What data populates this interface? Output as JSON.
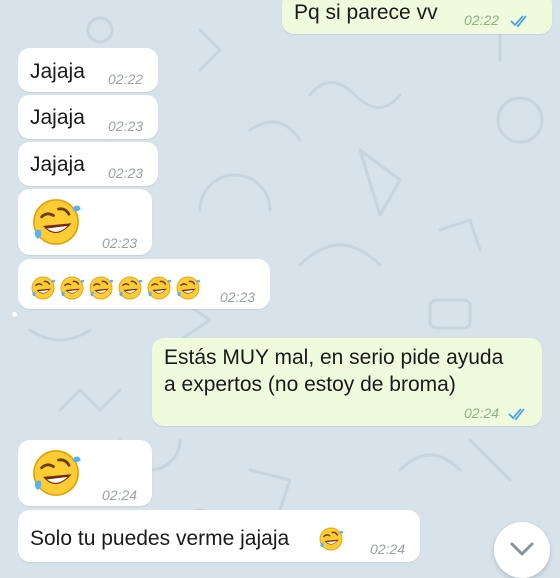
{
  "messages": [
    {
      "dir": "out",
      "text": "Pq si parece vv",
      "time": "02:22",
      "read": true
    },
    {
      "dir": "in",
      "text": "Jajaja",
      "time": "02:22"
    },
    {
      "dir": "in",
      "text": "Jajaja",
      "time": "02:23"
    },
    {
      "dir": "in",
      "text": "Jajaja",
      "time": "02:23"
    },
    {
      "dir": "in",
      "emoji": "rofl",
      "time": "02:23"
    },
    {
      "dir": "in",
      "emoji_count": 6,
      "time": "02:23"
    },
    {
      "dir": "out",
      "text_lines": [
        "Estás MUY mal, en serio pide ayuda",
        "a expertos (no estoy de broma)"
      ],
      "time": "02:24",
      "read": true
    },
    {
      "dir": "in",
      "emoji": "rofl",
      "time": "02:24"
    },
    {
      "dir": "in",
      "text": "Solo tu puedes verme jajaja",
      "time": "02:24"
    }
  ],
  "icons": {
    "emoji": "rolling-on-the-floor-laughing",
    "read_receipt": "double-check",
    "scroll": "chevron-down"
  },
  "colors": {
    "background": "#d7e2ea",
    "incoming_bubble": "#ffffff",
    "outgoing_bubble": "#eefbdc",
    "read_check": "#4fa3e0"
  }
}
